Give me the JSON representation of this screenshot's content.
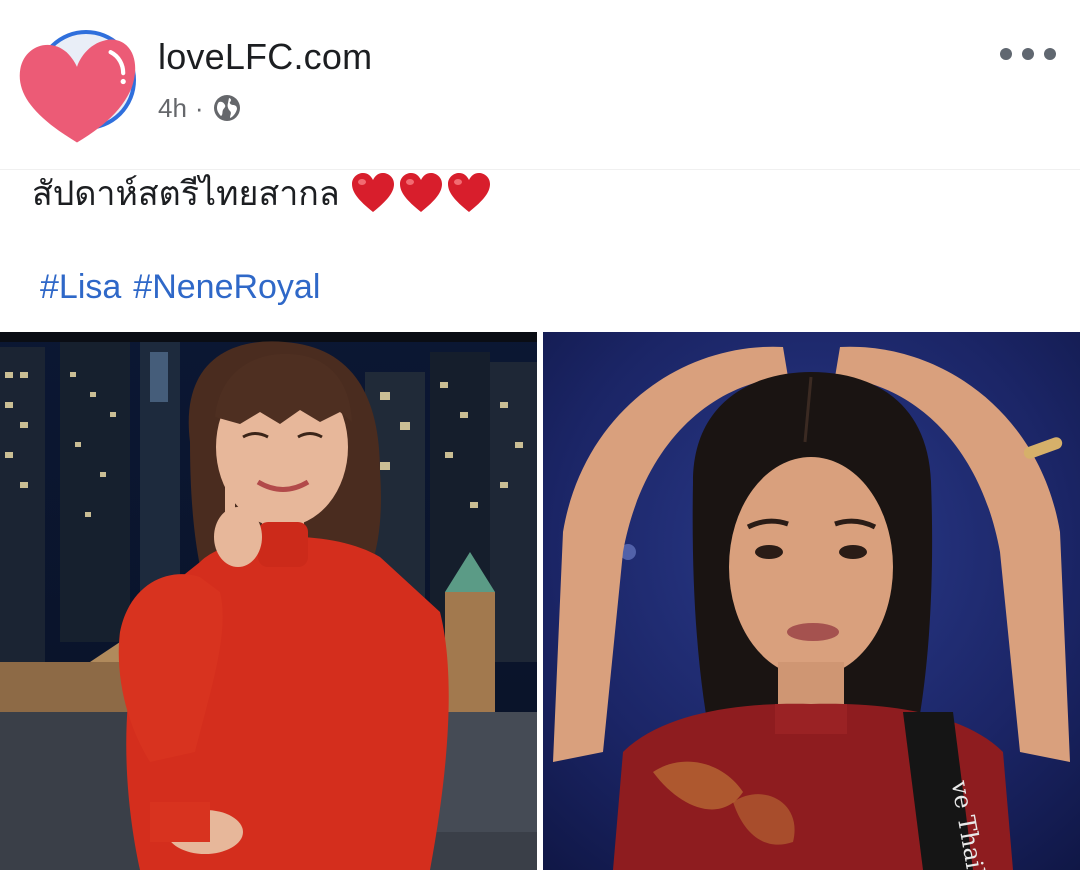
{
  "post": {
    "page_name": "loveLFC.com",
    "time": "4h",
    "separator": "·",
    "privacy_icon": "globe-icon",
    "more_icon": "more-options-icon",
    "text": "สัปดาห์สตรีไทยสากล",
    "emoji": [
      "❤️",
      "❤️",
      "❤️"
    ],
    "hashtags": [
      "#Lisa",
      "#NeneRoyal"
    ]
  },
  "photos": [
    {
      "description_icon": "photo-lisa"
    },
    {
      "description_icon": "photo-nene"
    }
  ],
  "colors": {
    "hashtag": "#2f68c8",
    "avatar_ring": "#2f6fdc",
    "heart_sticker": "#ec5b76",
    "emoji_heart": "#d81e2c"
  }
}
